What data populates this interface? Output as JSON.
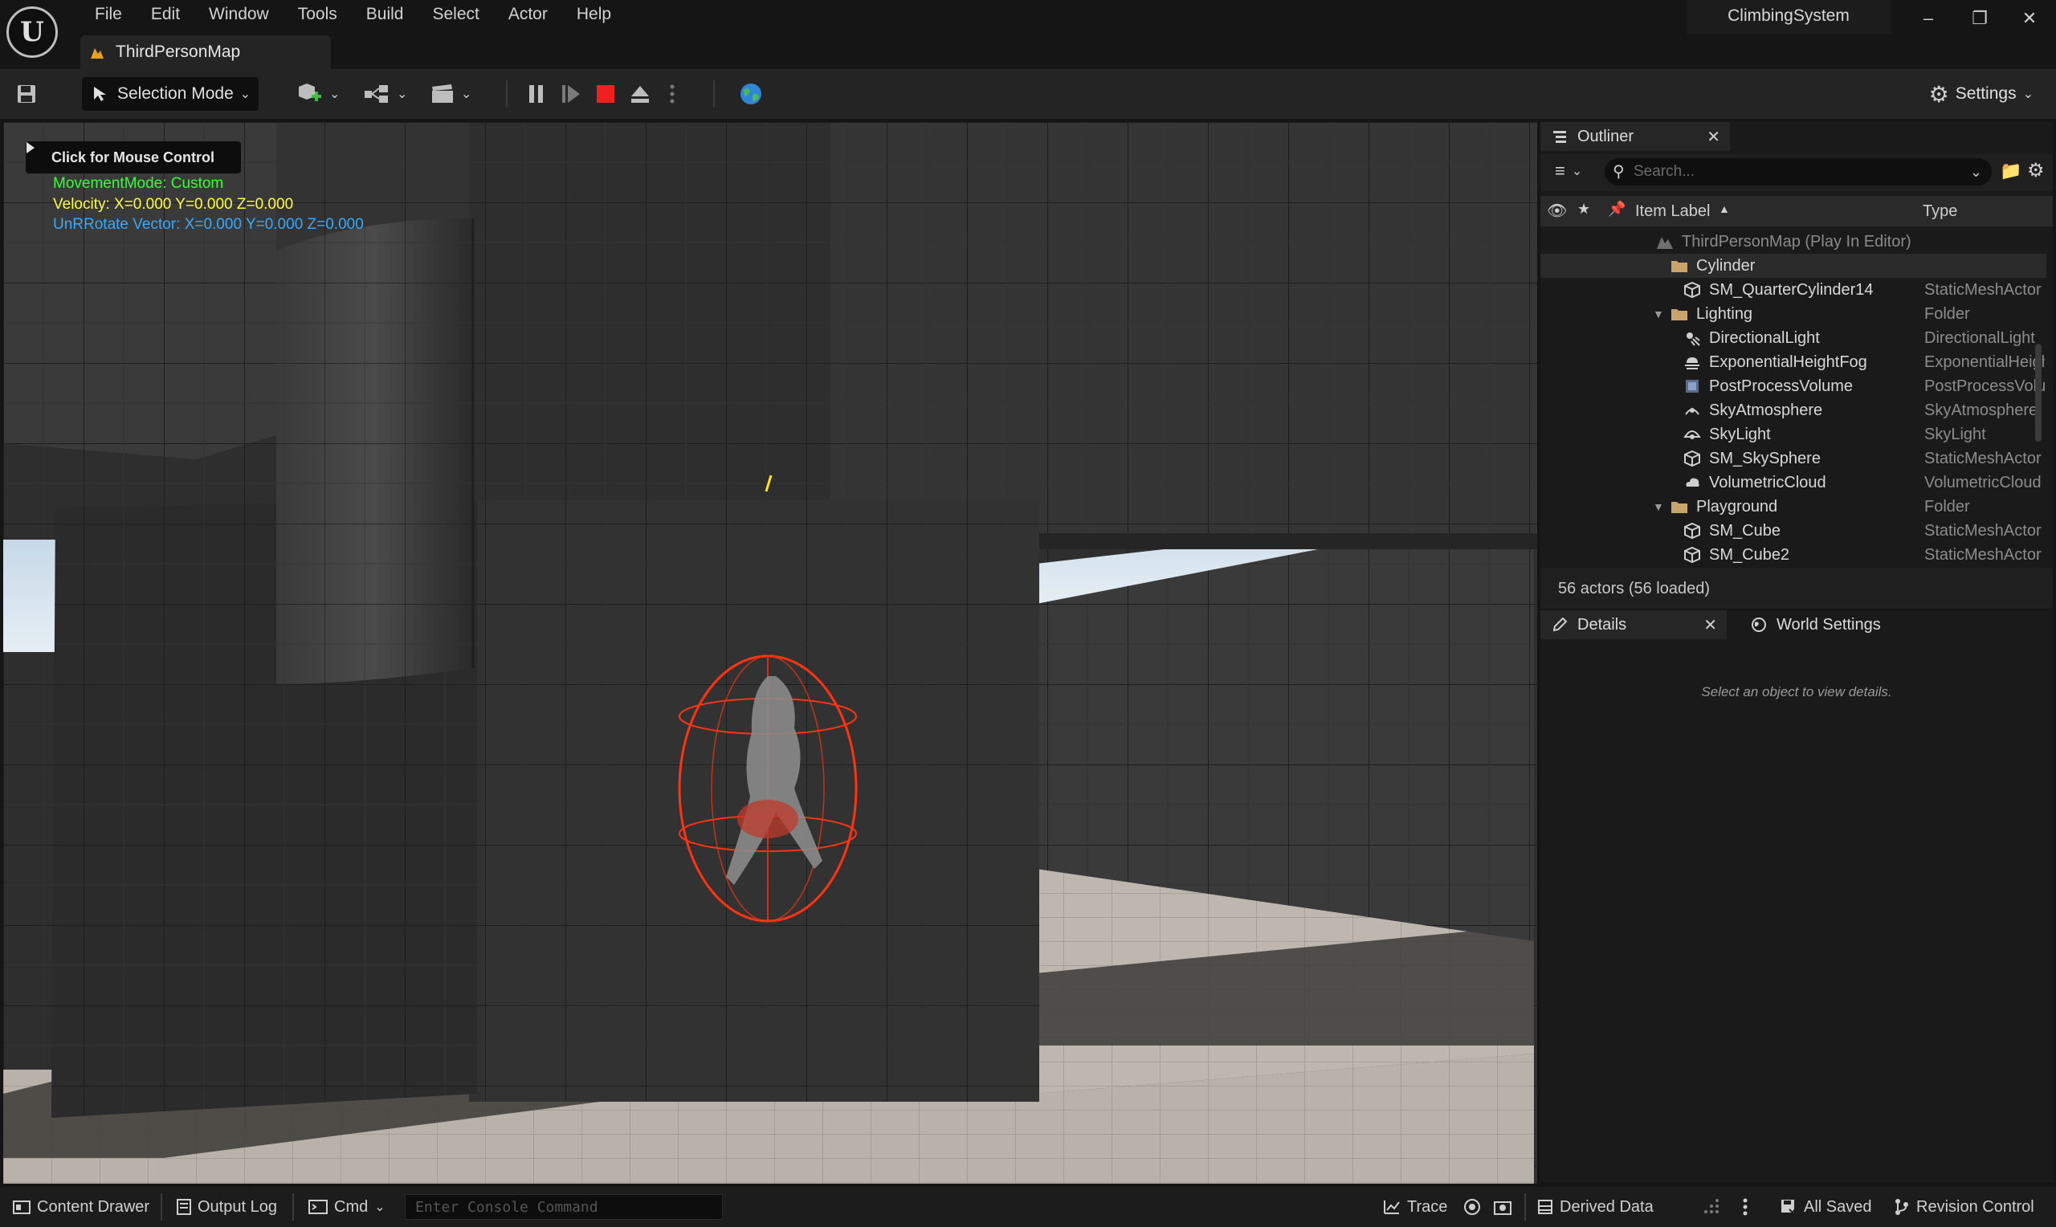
{
  "menu": [
    "File",
    "Edit",
    "Window",
    "Tools",
    "Build",
    "Select",
    "Actor",
    "Help"
  ],
  "document_tab": "ThirdPersonMap",
  "project_name": "ClimbingSystem",
  "toolbar": {
    "selection_mode": "Selection Mode",
    "settings": "Settings"
  },
  "viewport": {
    "mouse_control": "Click for Mouse Control",
    "debug": {
      "movement_mode": "MovementMode: Custom",
      "velocity": "Velocity: X=0.000 Y=0.000 Z=0.000",
      "unrotate": "UnRRotate Vector: X=0.000 Y=0.000 Z=0.000"
    },
    "colors": {
      "movement_mode": "#33ff33",
      "velocity": "#ffff33",
      "unrotate": "#33aaff",
      "capsule": "#ff3311"
    }
  },
  "outliner": {
    "title": "Outliner",
    "search_placeholder": "Search...",
    "col_label": "Item Label",
    "col_type": "Type",
    "rows": [
      {
        "name": "ThirdPersonMap (Play In Editor)",
        "type": "",
        "icon": "map-icon"
      },
      {
        "name": "Cylinder",
        "type": "",
        "icon": "folder-icon"
      },
      {
        "name": "SM_QuarterCylinder14",
        "type": "StaticMeshActor",
        "icon": "static-mesh-icon"
      },
      {
        "name": "Lighting",
        "type": "Folder",
        "icon": "folder-icon"
      },
      {
        "name": "DirectionalLight",
        "type": "DirectionalLight",
        "icon": "directional-light-icon"
      },
      {
        "name": "ExponentialHeightFog",
        "type": "ExponentialHeightFog",
        "icon": "fog-icon"
      },
      {
        "name": "PostProcessVolume",
        "type": "PostProcessVolume",
        "icon": "post-process-icon"
      },
      {
        "name": "SkyAtmosphere",
        "type": "SkyAtmosphere",
        "icon": "sky-atmosphere-icon"
      },
      {
        "name": "SkyLight",
        "type": "SkyLight",
        "icon": "sky-light-icon"
      },
      {
        "name": "SM_SkySphere",
        "type": "StaticMeshActor",
        "icon": "static-mesh-icon"
      },
      {
        "name": "VolumetricCloud",
        "type": "VolumetricCloud",
        "icon": "cloud-icon"
      },
      {
        "name": "Playground",
        "type": "Folder",
        "icon": "folder-icon"
      },
      {
        "name": "SM_Cube",
        "type": "StaticMeshActor",
        "icon": "static-mesh-icon"
      },
      {
        "name": "SM_Cube2",
        "type": "StaticMeshActor",
        "icon": "static-mesh-icon"
      }
    ],
    "footer": "56 actors (56 loaded)"
  },
  "details": {
    "title": "Details",
    "world_settings": "World Settings",
    "empty_message": "Select an object to view details."
  },
  "statusbar": {
    "content_drawer": "Content Drawer",
    "output_log": "Output Log",
    "cmd": "Cmd",
    "console_placeholder": "Enter Console Command",
    "trace": "Trace",
    "derived_data": "Derived Data",
    "all_saved": "All Saved",
    "revision_control": "Revision Control"
  }
}
